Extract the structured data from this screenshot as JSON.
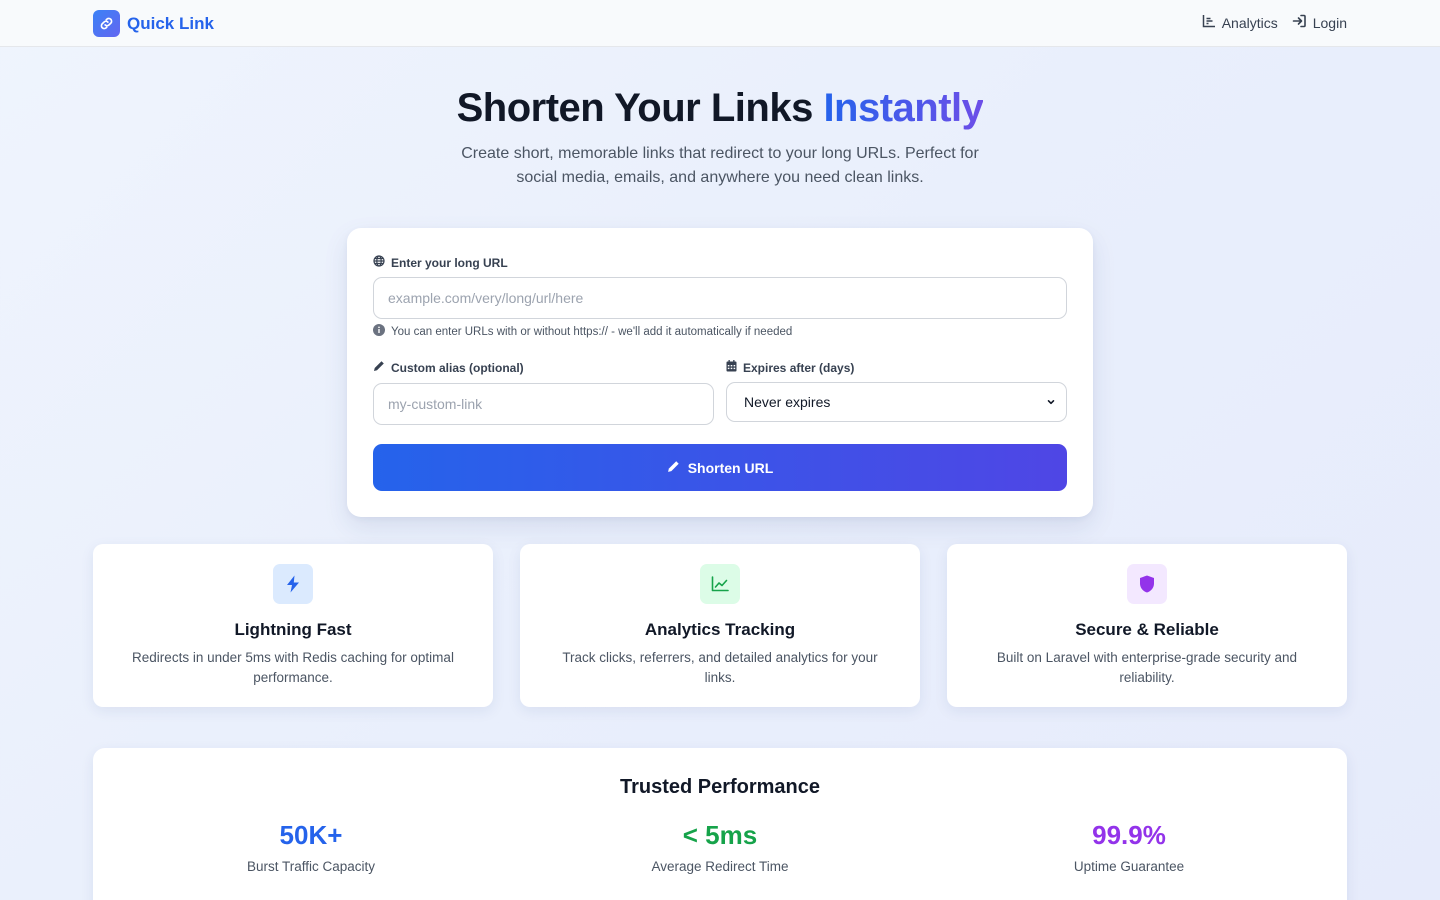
{
  "brand": {
    "name": "Quick Link",
    "icon": "link-icon"
  },
  "nav": {
    "analytics_label": "Analytics",
    "login_label": "Login"
  },
  "hero": {
    "title_main": "Shorten Your Links ",
    "title_accent": "Instantly",
    "subtitle": "Create short, memorable links that redirect to your long URLs. Perfect for social media, emails, and anywhere you need clean links."
  },
  "form": {
    "url_label": "Enter your long URL",
    "url_value": "",
    "url_placeholder": "example.com/very/long/url/here",
    "url_hint": "You can enter URLs with or without https:// - we'll add it automatically if needed",
    "alias_label": "Custom alias (optional)",
    "alias_value": "",
    "alias_placeholder": "my-custom-link",
    "expires_label": "Expires after (days)",
    "expires_selected": "Never expires",
    "submit_label": "Shorten URL"
  },
  "features": [
    {
      "title": "Lightning Fast",
      "description": "Redirects in under 5ms with Redis caching for optimal performance.",
      "icon": "bolt-icon",
      "icon_color": "#2563eb",
      "icon_bg": "#dbeafe"
    },
    {
      "title": "Analytics Tracking",
      "description": "Track clicks, referrers, and detailed analytics for your links.",
      "icon": "chart-line-icon",
      "icon_color": "#16a34a",
      "icon_bg": "#dcfce7"
    },
    {
      "title": "Secure & Reliable",
      "description": "Built on Laravel with enterprise-grade security and reliability.",
      "icon": "shield-icon",
      "icon_color": "#9333ea",
      "icon_bg": "#f3e8ff"
    }
  ],
  "stats": {
    "title": "Trusted Performance",
    "items": [
      {
        "value": "50K+",
        "label": "Burst Traffic Capacity",
        "color": "#2563eb"
      },
      {
        "value": "< 5ms",
        "label": "Average Redirect Time",
        "color": "#16a34a"
      },
      {
        "value": "99.9%",
        "label": "Uptime Guarantee",
        "color": "#9333ea"
      }
    ]
  },
  "colors": {
    "accent": "#2563eb",
    "accent_end": "#4f46e5"
  }
}
